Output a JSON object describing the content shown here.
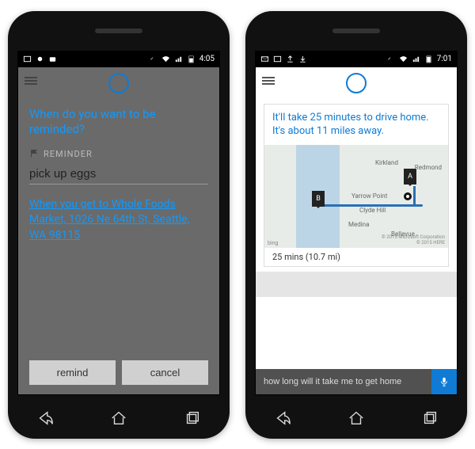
{
  "colors": {
    "accent": "#0f7bd4",
    "accent_light": "#0f9aff"
  },
  "left": {
    "statusbar": {
      "time": "4:05"
    },
    "prompt": "When do you want to be reminded?",
    "reminder_label": "REMINDER",
    "reminder_text": "pick up eggs",
    "location_link": "When you get to Whole Foods Market, 1026 Ne 64th St, Seattle, WA 98115",
    "buttons": {
      "remind": "remind",
      "cancel": "cancel"
    }
  },
  "right": {
    "statusbar": {
      "time": "7:01"
    },
    "card_text": "It'll take 25 minutes to drive home. It's about 11 miles away.",
    "map": {
      "marker_a": "A",
      "marker_b": "B",
      "labels": {
        "kirkland": "Kirkland",
        "redmond": "Redmond",
        "yarrow": "Yarrow Point",
        "clyde": "Clyde Hill",
        "medina": "Medina",
        "bellevue": "Bellevue"
      },
      "attribution": "© 2015 Microsoft Corporation\n© 2015 HERE",
      "bing": "bing"
    },
    "travel_summary": "25 mins (10.7 mi)",
    "query_text": "how long will it take me to get home"
  }
}
